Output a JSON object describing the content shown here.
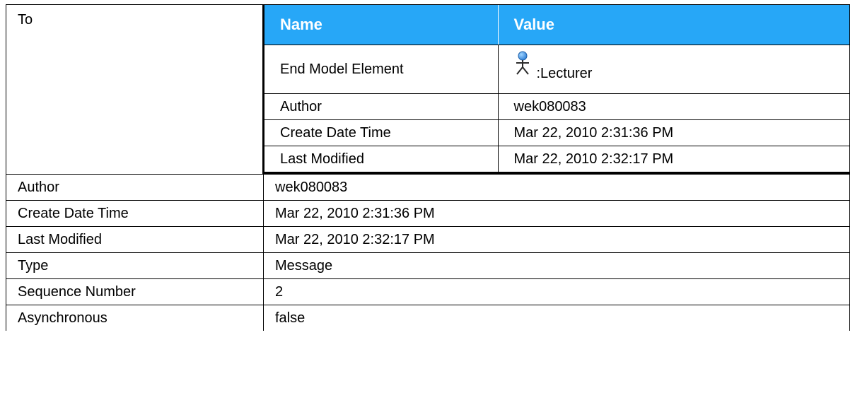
{
  "to_section": {
    "label": "To",
    "header": {
      "name": "Name",
      "value": "Value"
    },
    "rows": [
      {
        "name": "End Model Element",
        "value": ":Lecturer",
        "icon": "actor-icon"
      },
      {
        "name": "Author",
        "value": "wek080083"
      },
      {
        "name": "Create Date Time",
        "value": "Mar 22, 2010 2:31:36 PM"
      },
      {
        "name": "Last Modified",
        "value": "Mar 22, 2010 2:32:17 PM"
      }
    ]
  },
  "properties": [
    {
      "name": "Author",
      "value": "wek080083"
    },
    {
      "name": "Create Date Time",
      "value": "Mar 22, 2010 2:31:36 PM"
    },
    {
      "name": "Last Modified",
      "value": "Mar 22, 2010 2:32:17 PM"
    },
    {
      "name": "Type",
      "value": "Message"
    },
    {
      "name": "Sequence Number",
      "value": "2"
    },
    {
      "name": "Asynchronous",
      "value": "false"
    }
  ],
  "colors": {
    "header_background": "#27a7f7",
    "header_text": "#ffffff",
    "actor_head": "#2f7fd6"
  }
}
